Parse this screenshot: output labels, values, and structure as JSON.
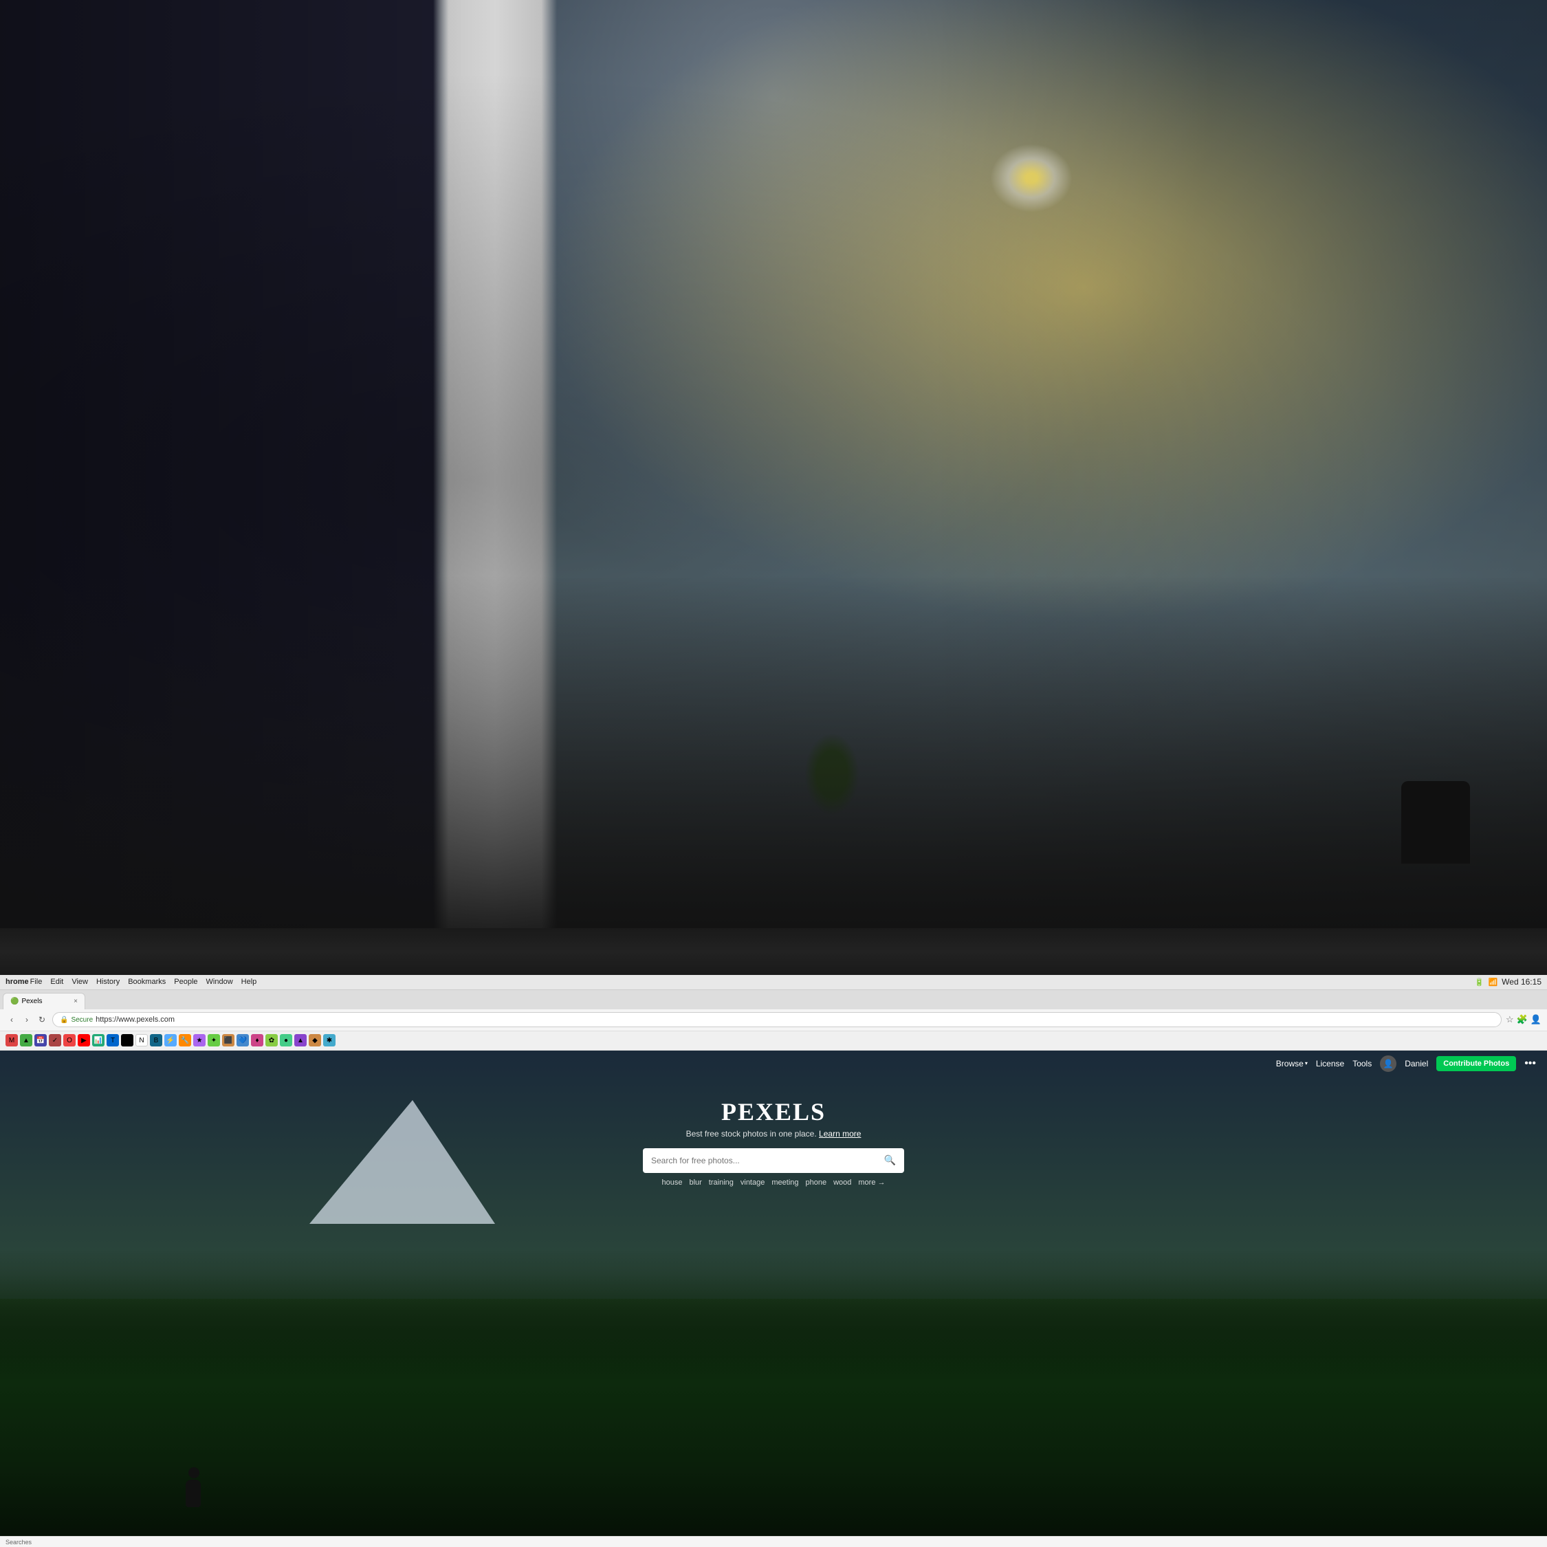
{
  "photo": {
    "alt": "Office interior background photo"
  },
  "browser": {
    "menubar": {
      "app_name": "hrome",
      "menu_items": [
        "File",
        "Edit",
        "View",
        "History",
        "Bookmarks",
        "People",
        "Window",
        "Help"
      ],
      "time": "Wed 16:15",
      "battery": "100%",
      "wifi": "WiFi"
    },
    "address_bar": {
      "secure_label": "Secure",
      "url": "https://www.pexels.com"
    },
    "tab": {
      "title": "Pexels",
      "close": "×"
    }
  },
  "website": {
    "nav": {
      "browse_label": "Browse",
      "license_label": "License",
      "tools_label": "Tools",
      "user_name": "Daniel",
      "contribute_label": "Contribute Photos",
      "more_icon": "•••"
    },
    "hero": {
      "title": "PEXELS",
      "subtitle": "Best free stock photos in one place.",
      "learn_more": "Learn more",
      "search_placeholder": "Search for free photos...",
      "tags": [
        "house",
        "blur",
        "training",
        "vintage",
        "meeting",
        "phone",
        "wood"
      ],
      "more_label": "more →"
    }
  },
  "statusbar": {
    "text": "Searches"
  }
}
